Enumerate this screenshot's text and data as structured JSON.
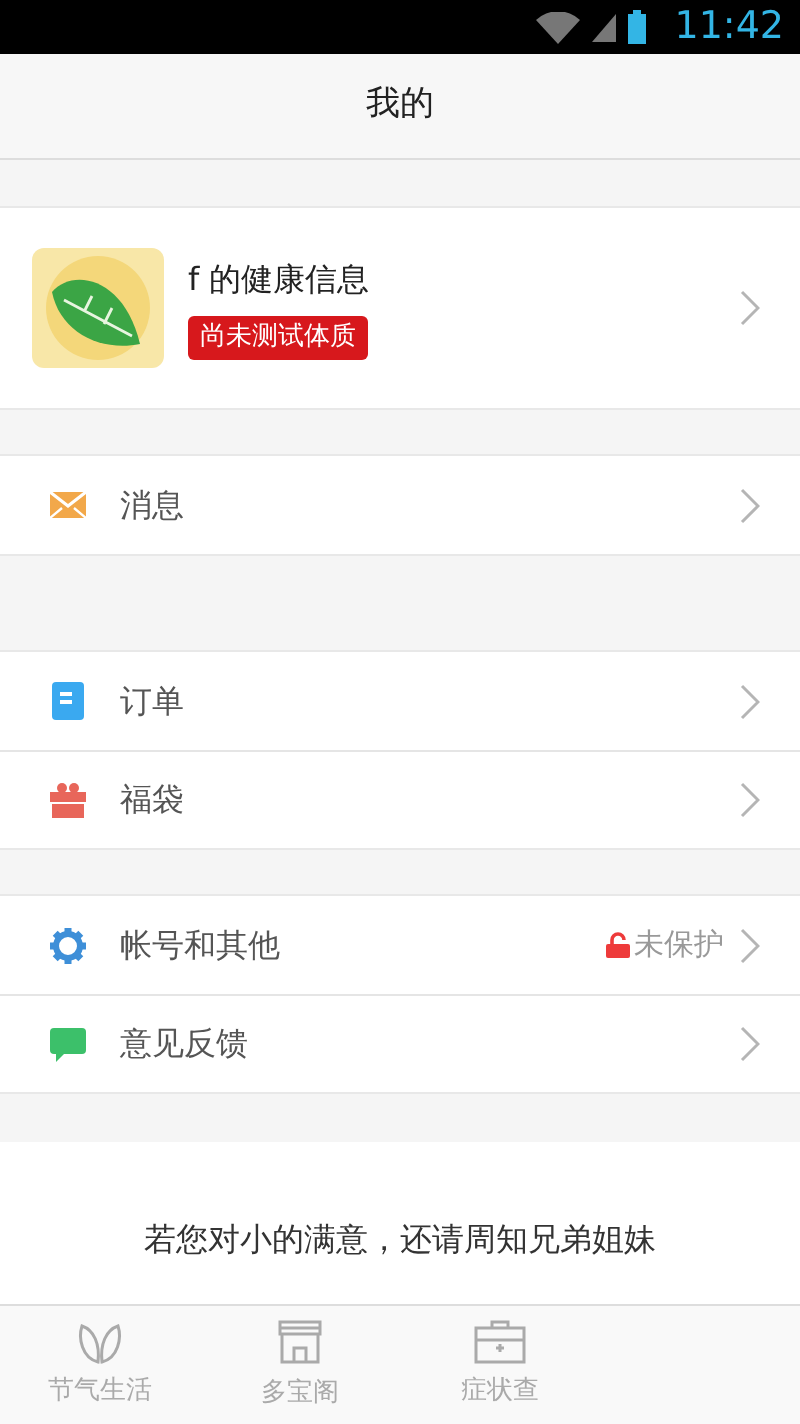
{
  "status_bar": {
    "time": "11:42"
  },
  "header": {
    "title": "我的"
  },
  "profile": {
    "name": "f 的健康信息",
    "badge": "尚未测试体质"
  },
  "groups": [
    [
      {
        "label": "消息",
        "kind": "mail"
      }
    ],
    [
      {
        "label": "订单",
        "kind": "doc"
      },
      {
        "label": "福袋",
        "kind": "gift"
      }
    ],
    [
      {
        "label": "帐号和其他",
        "kind": "gear",
        "status": "未保护"
      },
      {
        "label": "意见反馈",
        "kind": "chat"
      }
    ]
  ],
  "message": "若您对小的满意，还请周知兄弟姐妹",
  "tabs": [
    {
      "label": "节气生活",
      "kind": "leaf",
      "selected": false
    },
    {
      "label": "多宝阁",
      "kind": "shop",
      "selected": false
    },
    {
      "label": "症状查",
      "kind": "kit",
      "selected": false
    }
  ]
}
